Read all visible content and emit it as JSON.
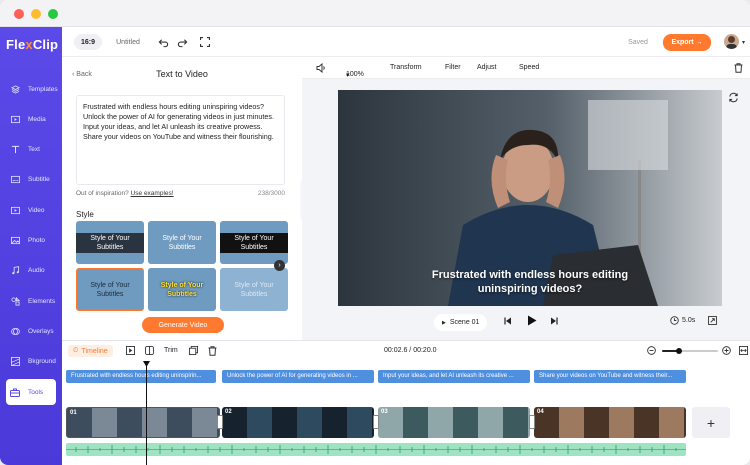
{
  "app": {
    "brand_a": "Fle",
    "brand_b": "x",
    "brand_c": "Clip"
  },
  "sidebar": {
    "items": [
      {
        "label": "Templates",
        "icon": "layers-icon"
      },
      {
        "label": "Media",
        "icon": "media-icon"
      },
      {
        "label": "Text",
        "icon": "text-icon"
      },
      {
        "label": "Subtitle",
        "icon": "subtitle-icon"
      },
      {
        "label": "Video",
        "icon": "video-icon"
      },
      {
        "label": "Photo",
        "icon": "photo-icon"
      },
      {
        "label": "Audio",
        "icon": "music-icon"
      },
      {
        "label": "Elements",
        "icon": "elements-icon"
      },
      {
        "label": "Overlays",
        "icon": "overlay-icon"
      },
      {
        "label": "Bkground",
        "icon": "background-icon"
      },
      {
        "label": "Tools",
        "icon": "toolbox-icon"
      }
    ],
    "active": "Tools"
  },
  "topbar": {
    "ratio": "16:9",
    "project_name": "Untitled",
    "saved": "Saved",
    "export_label": "Export →"
  },
  "panel": {
    "back": "Back",
    "title": "Text to Video",
    "text": "Frustrated with endless hours editing uninspiring videos? Unlock the power of AI for generating videos in just minutes. Input your ideas, and let AI unleash its creative prowess. Share your videos on YouTube and witness their flourishing.",
    "hint_prefix": "Out of inspiration?",
    "hint_link": "Use examples!",
    "counter": "238/3000",
    "style_label": "Style",
    "styles": [
      "Style of Your Subtitles",
      "Style of Your Subtitles",
      "Style of Your Subtitles",
      "Style of Your Subtitles",
      "Style of Your Subtitles",
      "Style of Your Subtitles"
    ],
    "generate": "Generate Video"
  },
  "preview": {
    "zoom": "100%",
    "tools": [
      "Transform",
      "Filter",
      "Adjust",
      "Speed"
    ],
    "caption_line1": "Frustrated with endless hours editing",
    "caption_line2": "uninspiring videos?",
    "scene": "Scene 01",
    "duration": "5.0s"
  },
  "timeline": {
    "label": "Timeline",
    "trim": "Trim",
    "time": "00:02.6 / 00:20.0",
    "zoom_level": 0.3,
    "subtitles": [
      "Frustrated with endless hours editing uninspirin...",
      "Unlock the power of AI for generating videos in ...",
      "Input your ideas, and let AI unleash its creative ...",
      "Share your videos on YouTube and witness their..."
    ],
    "clips": [
      "01",
      "02",
      "03",
      "04"
    ]
  },
  "colors": {
    "accent": "#5b49e8",
    "orange": "#ff7a2e",
    "subtitle_track": "#4f8fe0",
    "audio_track": "#9fe3c3"
  }
}
